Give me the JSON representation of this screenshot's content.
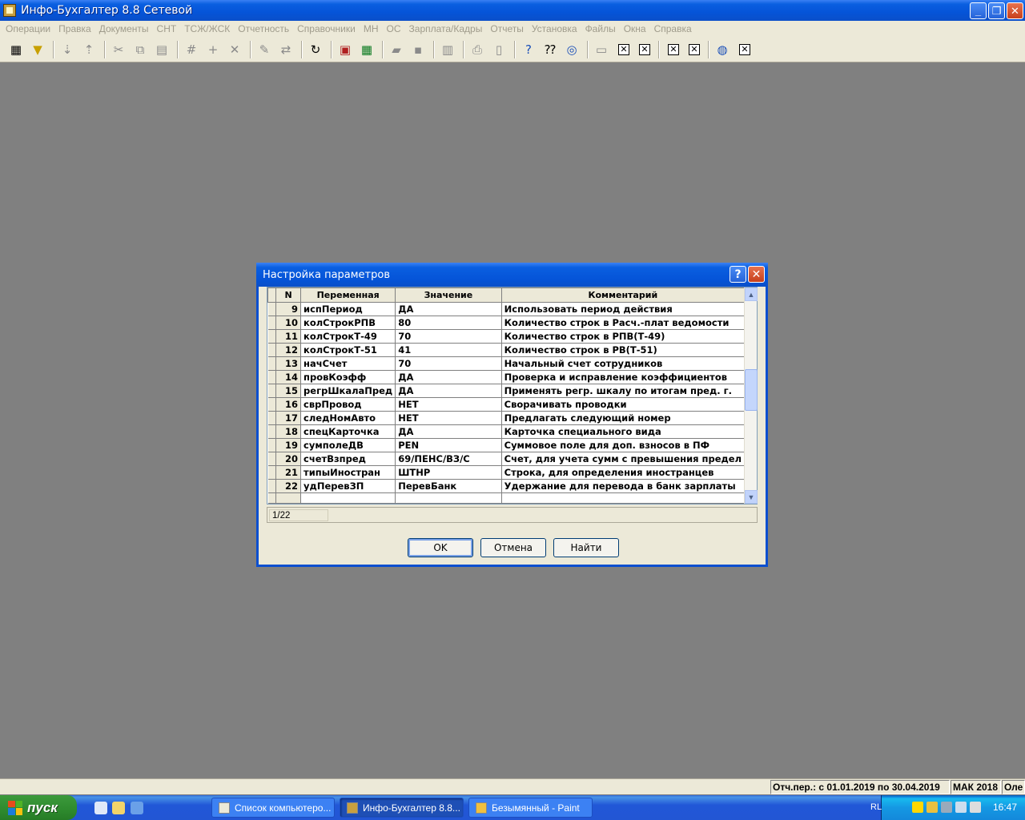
{
  "app": {
    "title": "Инфо-Бухгалтер 8.8 Сетевой"
  },
  "menu": [
    "Операции",
    "Правка",
    "Документы",
    "СНТ",
    "ТСЖ/ЖСК",
    "Отчетность",
    "Справочники",
    "МН",
    "ОС",
    "Зарплата/Кадры",
    "Отчеты",
    "Установка",
    "Файлы",
    "Окна",
    "Справка"
  ],
  "dialog": {
    "title": "Настройка параметров",
    "columns": {
      "num": "N",
      "var": "Переменная",
      "value": "Значение",
      "comment": "Комментарий"
    },
    "rows": [
      {
        "num": "9",
        "var": "испПериод",
        "value": "ДА",
        "comment": "Использовать период действия"
      },
      {
        "num": "10",
        "var": "колСтрокРПВ",
        "value": "80",
        "comment": "Количество строк в Расч.-плат ведомости"
      },
      {
        "num": "11",
        "var": "колСтрокТ-49",
        "value": "70",
        "comment": "Количество строк в РПВ(Т-49)"
      },
      {
        "num": "12",
        "var": "колСтрокТ-51",
        "value": "41",
        "comment": "Количество строк в РВ(Т-51)"
      },
      {
        "num": "13",
        "var": "начСчет",
        "value": "70",
        "comment": "Начальный счет сотрудников"
      },
      {
        "num": "14",
        "var": "провКоэфф",
        "value": "ДА",
        "comment": "Проверка и исправление коэффициентов"
      },
      {
        "num": "15",
        "var": "регрШкалаПред",
        "value": "ДА",
        "comment": "Применять регр. шкалу по итогам пред. г."
      },
      {
        "num": "16",
        "var": "сврПровод",
        "value": "НЕТ",
        "comment": "Сворачивать проводки"
      },
      {
        "num": "17",
        "var": "следНомАвто",
        "value": "НЕТ",
        "comment": "Предлагать следующий номер"
      },
      {
        "num": "18",
        "var": "спецКарточка",
        "value": "ДА",
        "comment": "Карточка специального вида"
      },
      {
        "num": "19",
        "var": "сумполеДВ",
        "value": "PEN",
        "comment": "Суммовое поле для доп. взносов в ПФ"
      },
      {
        "num": "20",
        "var": "счетВзпред",
        "value": "69/ПЕНС/ВЗ/С",
        "comment": "Счет, для учета сумм с превышения предел"
      },
      {
        "num": "21",
        "var": "типыИностран",
        "value": "ШТНР",
        "comment": "Строка, для определения иностранцев"
      },
      {
        "num": "22",
        "var": "удПеревЗП",
        "value": "ПеревБанк",
        "comment": "Удержание для перевода в банк зарплаты"
      }
    ],
    "position": "1/22",
    "ok_label": "OK",
    "cancel_label": "Отмена",
    "find_label": "Найти"
  },
  "status": {
    "period": "Отч.пер.: с 01.01.2019 по 30.04.2019",
    "org": "МАК 2018",
    "user": "Оле"
  },
  "taskbar": {
    "start_label": "пуск",
    "tasks": [
      "Список компьютеро...",
      "Инфо-Бухгалтер 8.8...",
      "Безымянный - Paint"
    ],
    "lang": "RL",
    "clock": "16:47"
  }
}
